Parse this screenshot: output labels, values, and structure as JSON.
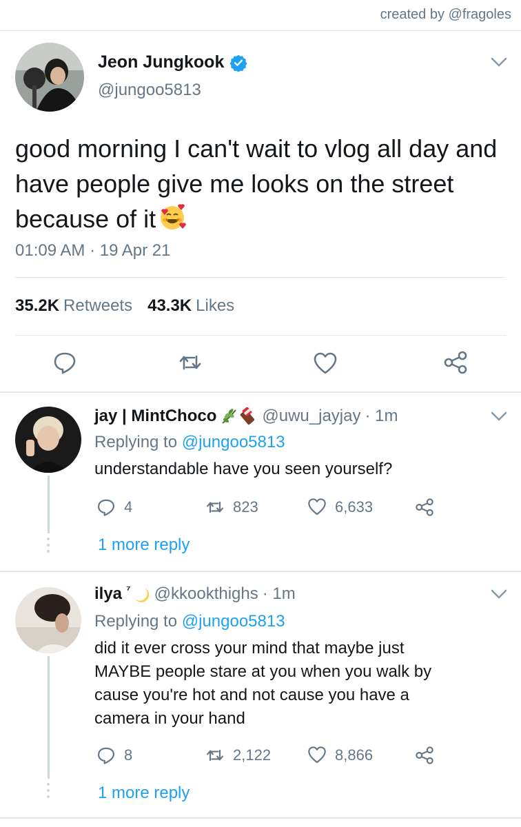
{
  "credit": "created by @fragoles",
  "main_tweet": {
    "name": "Jeon Jungkook",
    "handle": "@jungoo5813",
    "text": "good morning I can't wait to vlog all day and have people give me looks on the street because of it",
    "emoji": "smiling-face-with-hearts",
    "timestamp": "01:09 AM · 19 Apr 21",
    "retweets_count": "35.2K",
    "retweets_label": "Retweets",
    "likes_count": "43.3K",
    "likes_label": "Likes"
  },
  "replies": [
    {
      "name": "jay | MintChoco",
      "name_emojis": [
        "herb",
        "chocolate-bar"
      ],
      "handle": "@uwu_jayjay",
      "time": "· 1m",
      "replying_prefix": "Replying to",
      "replying_to": "@jungoo5813",
      "text": "understandable have you seen yourself?",
      "reply_count": "4",
      "retweet_count": "823",
      "like_count": "6,633",
      "more": "1 more reply"
    },
    {
      "name": "ilya",
      "name_suffix": "⁷",
      "name_emojis": [
        "crescent-moon"
      ],
      "handle": "@kkookthighs",
      "time": "· 1m",
      "replying_prefix": "Replying to",
      "replying_to": "@jungoo5813",
      "text_lines": [
        "did it ever cross your mind that maybe just",
        "MAYBE people stare at you when you walk by",
        "cause you're hot and not cause you have a",
        "camera in your hand"
      ],
      "reply_count": "8",
      "retweet_count": "2,122",
      "like_count": "8,866",
      "more": "1 more reply"
    }
  ],
  "colors": {
    "accent": "#1da1f2",
    "secondary_text": "#657786",
    "primary_text": "#14171a",
    "divider": "#e1e8ed"
  }
}
